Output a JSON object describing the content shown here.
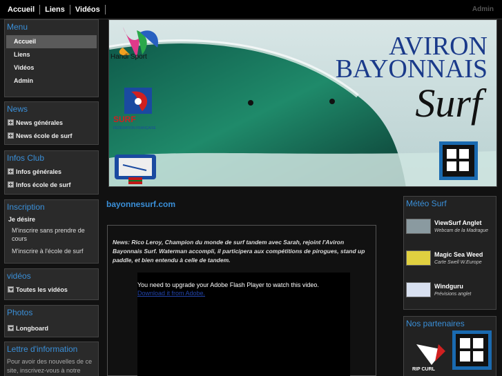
{
  "topnav": {
    "items": [
      "Accueil",
      "Liens",
      "Vidéos"
    ],
    "admin": "Admin"
  },
  "left": {
    "menu": {
      "title": "Menu",
      "items": [
        "Accueil",
        "Liens",
        "Vidéos",
        "Admin"
      ]
    },
    "news": {
      "title": "News",
      "items": [
        "News générales",
        "News école de surf"
      ]
    },
    "infos": {
      "title": "Infos Club",
      "items": [
        "Infos générales",
        "Infos école de surf"
      ]
    },
    "inscription": {
      "title": "Inscription",
      "label": "Je désire",
      "items": [
        "M'inscrire sans prendre de cours",
        "M'inscrire à l'école de surf"
      ]
    },
    "videos": {
      "title": "vidéos",
      "items": [
        "Toutes les vidéos"
      ]
    },
    "photos": {
      "title": "Photos",
      "items": [
        "Longboard"
      ]
    },
    "newsletter": {
      "title": "Lettre d'information",
      "text_line1": "Pour avoir des nouvelles de ce",
      "text_line2": "site, inscrivez-vous à notre"
    }
  },
  "banner": {
    "line1": "AVIRON",
    "line2": "BAYONNAIS",
    "line3": "Surf",
    "handisport": "Handi Sport",
    "ffs_surf": "SURF",
    "ffs_sub": "FÉDÉRATION FRANÇAISE",
    "hoff": "HOFF"
  },
  "main": {
    "site_link": "bayonnesurf.com",
    "news_text": "News:  Rico Leroy, Champion du monde de surf tandem avec Sarah, rejoint l'Aviron Bayonnais Surf. Waterman accompli, il participera aux compétitions de pirogues, stand up paddle, et bien entendu à celle de tandem.",
    "flash_msg": "You need to upgrade your Adobe Flash Player to watch this video.",
    "flash_link": "Download it from Adobe."
  },
  "right": {
    "meteo": {
      "title": "Météo Surf",
      "links": [
        {
          "title": "ViewSurf Anglet",
          "sub": "Webcam de la Madrague",
          "color": "#8a9aa0"
        },
        {
          "title": "Magic Sea Weed",
          "sub": "Carte Swell W.Europe",
          "color": "#e0d040"
        },
        {
          "title": "Windguru",
          "sub": "Prévisions anglet",
          "color": "#d8e0f0"
        }
      ]
    },
    "partners": {
      "title": "Nos partenaires",
      "ripcurl": "RIP CURL",
      "hoff": "HOFF"
    }
  }
}
